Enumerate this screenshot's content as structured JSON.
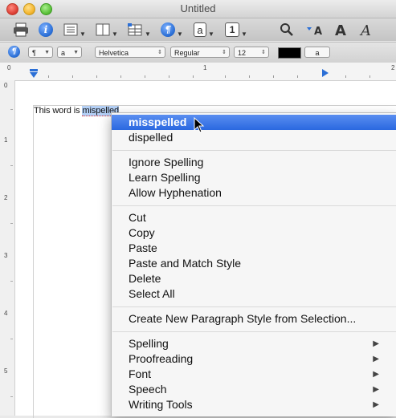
{
  "window": {
    "title": "Untitled"
  },
  "toolbar": {
    "icons": [
      "print-icon",
      "info-icon",
      "list-view-icon",
      "columns-icon",
      "insert-table-icon",
      "paragraph-icon",
      "text-box-icon",
      "numbered-list-icon",
      "search-icon",
      "font-size-down-icon",
      "font-size-up-icon",
      "italic-font-icon"
    ],
    "label_a": "a",
    "label_1": "1"
  },
  "formatbar": {
    "para_style": "¶",
    "char_style": "a",
    "font_family": "Helvetica",
    "font_style": "Regular",
    "font_size": "12",
    "text_color": "#000000",
    "highlight_label": "a"
  },
  "ruler": {
    "labels": [
      "0",
      "1",
      "2"
    ]
  },
  "vruler": {
    "labels": [
      "0",
      "1",
      "2",
      "3",
      "4",
      "5"
    ]
  },
  "document": {
    "text_before": "This word is ",
    "selected_word": "mispelled"
  },
  "context_menu": {
    "suggestions": [
      "misspelled",
      "dispelled"
    ],
    "spelling_actions": [
      "Ignore Spelling",
      "Learn Spelling",
      "Allow Hyphenation"
    ],
    "edit_actions": [
      "Cut",
      "Copy",
      "Paste",
      "Paste and Match Style",
      "Delete",
      "Select All"
    ],
    "style_action": "Create New Paragraph Style from Selection...",
    "submenus": [
      "Spelling",
      "Proofreading",
      "Font",
      "Speech",
      "Writing Tools"
    ],
    "submenu_arrow": "▶"
  },
  "colors": {
    "highlight": "#2a68e0",
    "selection": "#b3cff5"
  }
}
